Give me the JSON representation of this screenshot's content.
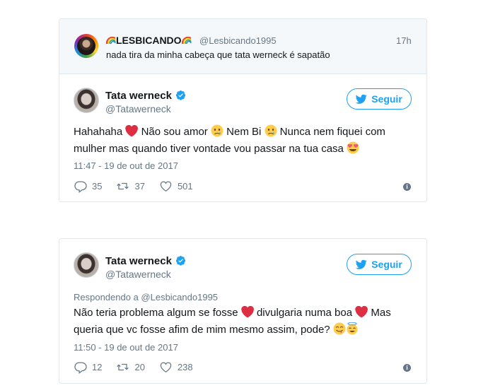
{
  "quoted": {
    "display_name": "LESBICANDO",
    "handle": "@Lesbicando1995",
    "time": "17h",
    "text": "nada tira da minha cabeça que tata werneck é sapatão"
  },
  "tweets": [
    {
      "display_name": "Tata werneck",
      "handle": "@Tatawerneck",
      "follow_label": "Seguir",
      "text_parts": [
        "Hahahaha",
        "Não sou amor",
        "Nem Bi",
        "Nunca nem fiquei com",
        "mulher mas quando tiver vontade vou passar na tua casa"
      ],
      "timestamp": "11:47 - 19 de out de 2017",
      "replies": "35",
      "retweets": "37",
      "likes": "501"
    },
    {
      "display_name": "Tata werneck",
      "handle": "@Tatawerneck",
      "follow_label": "Seguir",
      "replying_to": "Respondendo a @Lesbicando1995",
      "text_parts": [
        "Não teria problema algum se fosse",
        "divulgaria numa boa",
        "Mas",
        "queria que vc fosse afim de mim mesmo assim, pode?"
      ],
      "timestamp": "11:50 - 19 de out de 2017",
      "replies": "12",
      "retweets": "20",
      "likes": "238"
    }
  ],
  "colors": {
    "accent": "#1da1f2",
    "muted": "#657786",
    "heart": "#dd2e44",
    "border": "#e1e8ed"
  },
  "icons": [
    "rainbow-flag-icon",
    "verified-icon",
    "twitter-bird-icon",
    "reply-icon",
    "retweet-icon",
    "like-icon",
    "info-icon",
    "red-heart-emoji",
    "crying-face-emoji",
    "heart-eyes-emoji",
    "yum-face-emoji",
    "smiling-halo-emoji"
  ]
}
